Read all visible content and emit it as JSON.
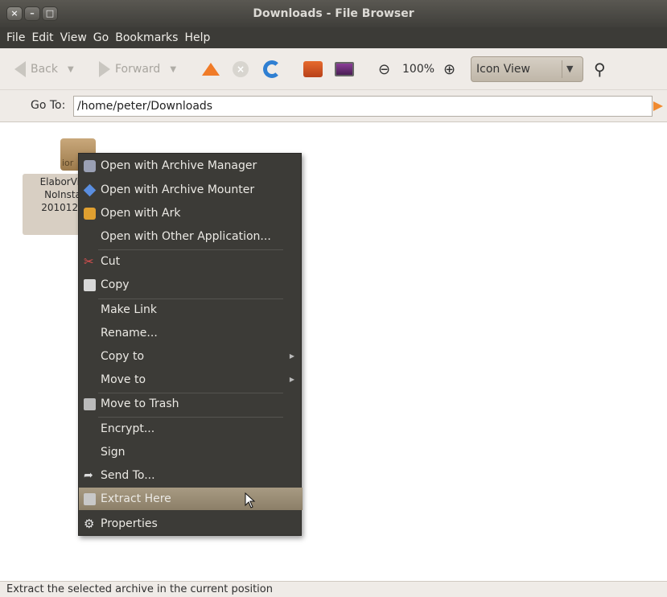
{
  "window": {
    "title": "Downloads - File Browser"
  },
  "menubar": [
    "File",
    "Edit",
    "View",
    "Go",
    "Bookmarks",
    "Help"
  ],
  "toolbar": {
    "back_label": "Back",
    "forward_label": "Forward",
    "zoom_level": "100%",
    "view_mode": "Icon View"
  },
  "location": {
    "label": "Go To:",
    "path": "/home/peter/Downloads"
  },
  "file": {
    "icon_text": "ior",
    "name_lines": [
      "ElaborVie",
      "NoInsta",
      "2010121"
    ]
  },
  "context_menu": {
    "items": [
      {
        "label": "Open with Archive Manager"
      },
      {
        "label": "Open with Archive Mounter"
      },
      {
        "label": "Open with Ark"
      },
      {
        "label": "Open with Other Application..."
      },
      {
        "label": "Cut"
      },
      {
        "label": "Copy"
      },
      {
        "label": "Make Link"
      },
      {
        "label": "Rename..."
      },
      {
        "label": "Copy to"
      },
      {
        "label": "Move to"
      },
      {
        "label": "Move to Trash"
      },
      {
        "label": "Encrypt..."
      },
      {
        "label": "Sign"
      },
      {
        "label": "Send To..."
      },
      {
        "label": "Extract Here"
      },
      {
        "label": "Properties"
      }
    ]
  },
  "status": {
    "text": "Extract the selected archive in the current position"
  }
}
